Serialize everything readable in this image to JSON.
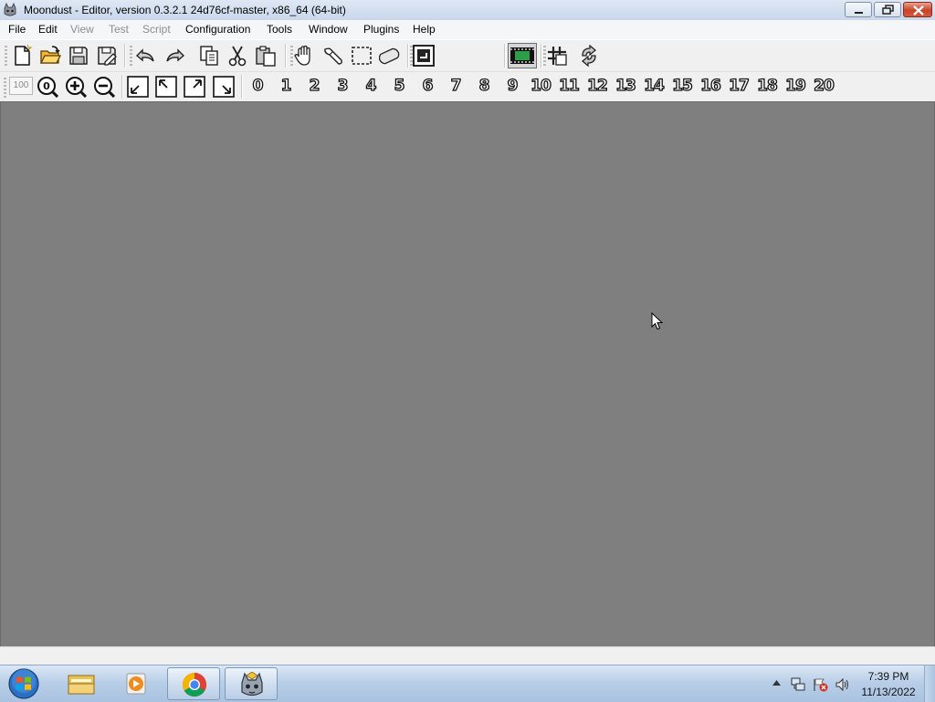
{
  "window": {
    "title": "Moondust - Editor, version 0.3.2.1 24d76cf-master, x86_64 (64-bit)"
  },
  "menu": {
    "items": [
      {
        "label": "File",
        "enabled": true
      },
      {
        "label": "Edit",
        "enabled": true
      },
      {
        "label": "View",
        "enabled": false
      },
      {
        "label": "Test",
        "enabled": false
      },
      {
        "label": "Script",
        "enabled": false
      },
      {
        "label": "Configuration",
        "enabled": true
      },
      {
        "label": "Tools",
        "enabled": true
      },
      {
        "label": "Window",
        "enabled": true
      },
      {
        "label": "Plugins",
        "enabled": true
      },
      {
        "label": "Help",
        "enabled": true
      }
    ]
  },
  "toolbar_main": {
    "icons": [
      "new-file-icon",
      "open-folder-icon",
      "save-icon",
      "save-as-icon",
      "undo-icon",
      "redo-icon",
      "copy-icon",
      "cut-icon",
      "paste-icon",
      "hand-icon",
      "eraser-icon",
      "selection-icon",
      "resize-icon",
      "exit-editor-icon",
      "playback-icon",
      "grid-icon",
      "reload-icon"
    ]
  },
  "toolbar_layers": {
    "zoom_value": "100",
    "layers": [
      "0",
      "1",
      "2",
      "3",
      "4",
      "5",
      "6",
      "7",
      "8",
      "9",
      "10",
      "11",
      "12",
      "13",
      "14",
      "15",
      "16",
      "17",
      "18",
      "19",
      "20"
    ]
  },
  "taskbar": {
    "apps": [
      "file-explorer-icon",
      "media-player-icon",
      "chrome-icon",
      "moondust-icon"
    ],
    "time": "7:39 PM",
    "date": "11/13/2022"
  }
}
